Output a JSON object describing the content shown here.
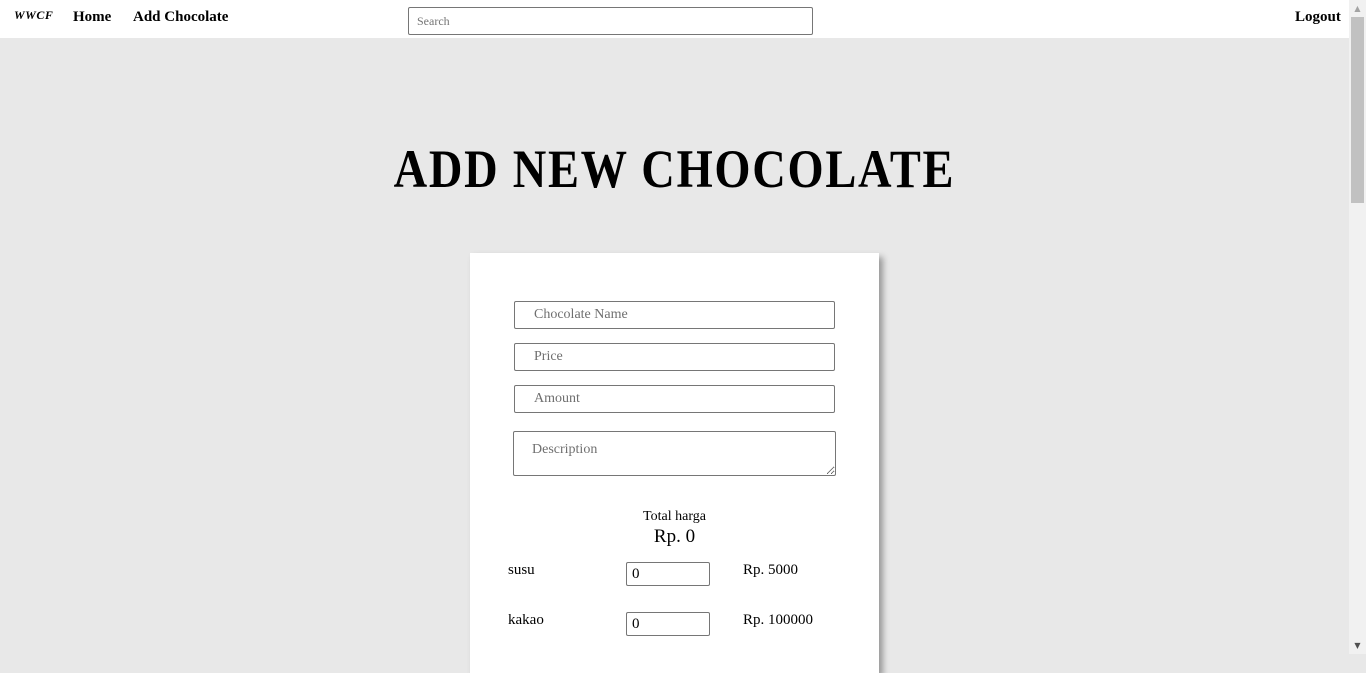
{
  "navbar": {
    "logo": "WWCF",
    "home": "Home",
    "add_chocolate": "Add Chocolate",
    "search_placeholder": "Search",
    "logout": "Logout"
  },
  "page": {
    "title": "ADD NEW CHOCOLATE"
  },
  "form": {
    "name_placeholder": "Chocolate Name",
    "price_placeholder": "Price",
    "amount_placeholder": "Amount",
    "description_placeholder": "Description",
    "total_label": "Total harga",
    "total_value": "Rp. 0",
    "ingredients": [
      {
        "name": "susu",
        "qty": "0",
        "price": "Rp. 5000"
      },
      {
        "name": "kakao",
        "qty": "0",
        "price": "Rp. 100000"
      }
    ]
  },
  "icons": {
    "scroll_up": "▲",
    "scroll_down": "▼"
  }
}
